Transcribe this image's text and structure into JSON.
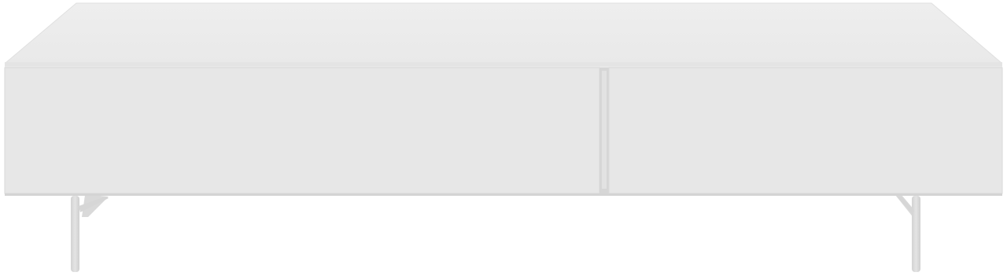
{
  "image": {
    "subject": "tv-bench",
    "colors": {
      "background": "#ffffff",
      "top_surface": "#ececec",
      "top_edge": "#e2e2e2",
      "front_panel": "#e6e6e6",
      "front_shade": "#dedede",
      "gap_shadow": "#d0d0d0",
      "legs": "#dcdcdc",
      "leg_shadow": "#c9c9c9"
    },
    "parts": {
      "drawers": 2,
      "legs_visible": 2
    }
  }
}
